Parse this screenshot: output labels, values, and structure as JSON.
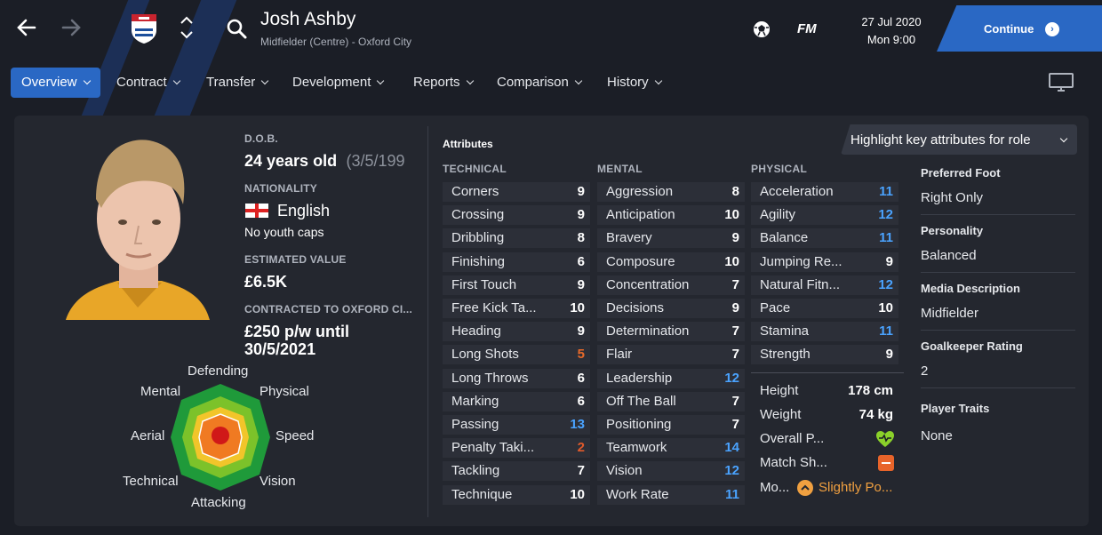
{
  "colors": {
    "accent": "#2a68c4",
    "attr_blue": "#4aa3ff",
    "attr_red": "#e05a2b",
    "attr_orange": "#e86a2a",
    "attr_white": "#ffffff",
    "morale": "#f0a040"
  },
  "header": {
    "player_name": "Josh Ashby",
    "player_subtitle": "Midfielder (Centre) - Oxford City",
    "date": "27 Jul 2020",
    "time": "Mon 9:00",
    "fm_label": "FM",
    "continue_label": "Continue"
  },
  "tabs": [
    {
      "label": "Overview",
      "active": true
    },
    {
      "label": "Contract"
    },
    {
      "label": "Transfer"
    },
    {
      "label": "Development"
    },
    {
      "label": "Reports"
    },
    {
      "label": "Comparison"
    },
    {
      "label": "History"
    }
  ],
  "profile": {
    "dob_label": "D.O.B.",
    "age": "24 years old",
    "dob": "(3/5/199",
    "nationality_label": "NATIONALITY",
    "nationality": "English",
    "youth_caps": "No youth caps",
    "value_label": "ESTIMATED VALUE",
    "value": "£6.5K",
    "contract_label": "CONTRACTED TO OXFORD CI...",
    "contract_line1": "£250 p/w until",
    "contract_line2": "30/5/2021"
  },
  "radar": {
    "labels": [
      "Defending",
      "Physical",
      "Speed",
      "Vision",
      "Attacking",
      "Technical",
      "Aerial",
      "Mental"
    ]
  },
  "attributes": {
    "title": "Attributes",
    "highlight_dropdown": "Highlight key attributes for role",
    "technical_header": "TECHNICAL",
    "mental_header": "MENTAL",
    "physical_header": "PHYSICAL",
    "technical": [
      {
        "name": "Corners",
        "value": "9",
        "color": "white"
      },
      {
        "name": "Crossing",
        "value": "9",
        "color": "white"
      },
      {
        "name": "Dribbling",
        "value": "8",
        "color": "white"
      },
      {
        "name": "Finishing",
        "value": "6",
        "color": "white"
      },
      {
        "name": "First Touch",
        "value": "9",
        "color": "white"
      },
      {
        "name": "Free Kick Ta...",
        "value": "10",
        "color": "white"
      },
      {
        "name": "Heading",
        "value": "9",
        "color": "white"
      },
      {
        "name": "Long Shots",
        "value": "5",
        "color": "orange"
      },
      {
        "name": "Long Throws",
        "value": "6",
        "color": "white"
      },
      {
        "name": "Marking",
        "value": "6",
        "color": "white"
      },
      {
        "name": "Passing",
        "value": "13",
        "color": "blue"
      },
      {
        "name": "Penalty Taki...",
        "value": "2",
        "color": "red"
      },
      {
        "name": "Tackling",
        "value": "7",
        "color": "white"
      },
      {
        "name": "Technique",
        "value": "10",
        "color": "white"
      }
    ],
    "mental": [
      {
        "name": "Aggression",
        "value": "8",
        "color": "white"
      },
      {
        "name": "Anticipation",
        "value": "10",
        "color": "white"
      },
      {
        "name": "Bravery",
        "value": "9",
        "color": "white"
      },
      {
        "name": "Composure",
        "value": "10",
        "color": "white"
      },
      {
        "name": "Concentration",
        "value": "7",
        "color": "white"
      },
      {
        "name": "Decisions",
        "value": "9",
        "color": "white"
      },
      {
        "name": "Determination",
        "value": "7",
        "color": "white"
      },
      {
        "name": "Flair",
        "value": "7",
        "color": "white"
      },
      {
        "name": "Leadership",
        "value": "12",
        "color": "blue"
      },
      {
        "name": "Off The Ball",
        "value": "7",
        "color": "white"
      },
      {
        "name": "Positioning",
        "value": "7",
        "color": "white"
      },
      {
        "name": "Teamwork",
        "value": "14",
        "color": "blue"
      },
      {
        "name": "Vision",
        "value": "12",
        "color": "blue"
      },
      {
        "name": "Work Rate",
        "value": "11",
        "color": "blue"
      }
    ],
    "physical": [
      {
        "name": "Acceleration",
        "value": "11",
        "color": "blue"
      },
      {
        "name": "Agility",
        "value": "12",
        "color": "blue"
      },
      {
        "name": "Balance",
        "value": "11",
        "color": "blue"
      },
      {
        "name": "Jumping Re...",
        "value": "9",
        "color": "white"
      },
      {
        "name": "Natural Fitn...",
        "value": "12",
        "color": "blue"
      },
      {
        "name": "Pace",
        "value": "10",
        "color": "white"
      },
      {
        "name": "Stamina",
        "value": "11",
        "color": "blue"
      },
      {
        "name": "Strength",
        "value": "9",
        "color": "white"
      }
    ]
  },
  "physical_info": {
    "height_label": "Height",
    "height": "178 cm",
    "weight_label": "Weight",
    "weight": "74 kg",
    "overall_label": "Overall P...",
    "match_label": "Match Sh...",
    "morale_label": "Mo...",
    "morale": "Slightly Po..."
  },
  "side": {
    "foot_label": "Preferred Foot",
    "foot": "Right Only",
    "personality_label": "Personality",
    "personality": "Balanced",
    "media_label": "Media Description",
    "media": "Midfielder",
    "gk_label": "Goalkeeper Rating",
    "gk": "2",
    "traits_label": "Player Traits",
    "traits": "None"
  }
}
